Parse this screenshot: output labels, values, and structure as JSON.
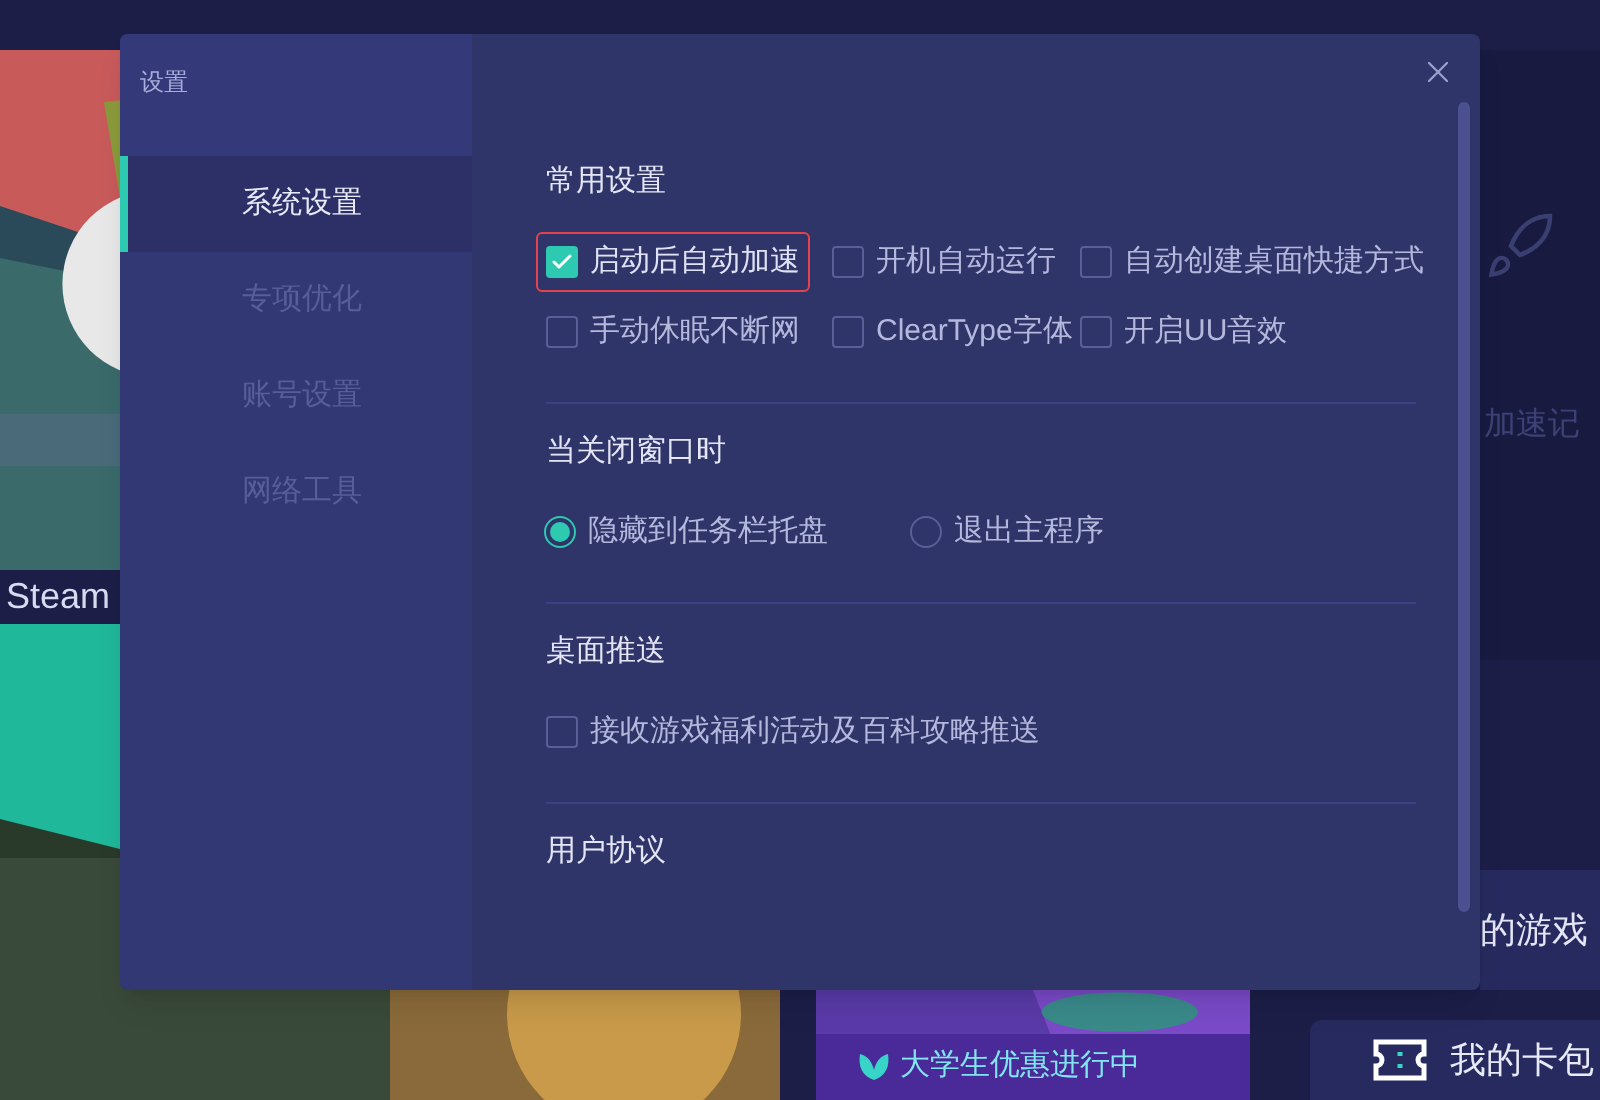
{
  "background": {
    "card_caption": "Steam",
    "side_label": "加速记",
    "games_button": "的游戏",
    "promo_label": "大学生优惠进行中",
    "wallet_button": "我的卡包"
  },
  "dialog": {
    "title": "设置",
    "nav": [
      {
        "label": "系统设置",
        "selected": true
      },
      {
        "label": "专项优化",
        "selected": false
      },
      {
        "label": "账号设置",
        "selected": false
      },
      {
        "label": "网络工具",
        "selected": false
      }
    ],
    "sections": [
      {
        "heading": "常用设置",
        "kind": "checkboxes",
        "items": [
          {
            "label": "启动后自动加速",
            "checked": true,
            "focused": true
          },
          {
            "label": "开机自动运行",
            "checked": false,
            "focused": false
          },
          {
            "label": "自动创建桌面快捷方式",
            "checked": false,
            "focused": false
          },
          {
            "label": "手动休眠不断网",
            "checked": false,
            "focused": false
          },
          {
            "label": "ClearType字体",
            "checked": false,
            "focused": false
          },
          {
            "label": "开启UU音效",
            "checked": false,
            "focused": false
          }
        ]
      },
      {
        "heading": "当关闭窗口时",
        "kind": "radios",
        "items": [
          {
            "label": "隐藏到任务栏托盘",
            "selected": true
          },
          {
            "label": "退出主程序",
            "selected": false
          }
        ]
      },
      {
        "heading": "桌面推送",
        "kind": "checkboxes",
        "items": [
          {
            "label": "接收游戏福利活动及百科攻略推送",
            "checked": false,
            "focused": false
          }
        ]
      },
      {
        "heading": "用户协议",
        "kind": "heading"
      }
    ]
  }
}
